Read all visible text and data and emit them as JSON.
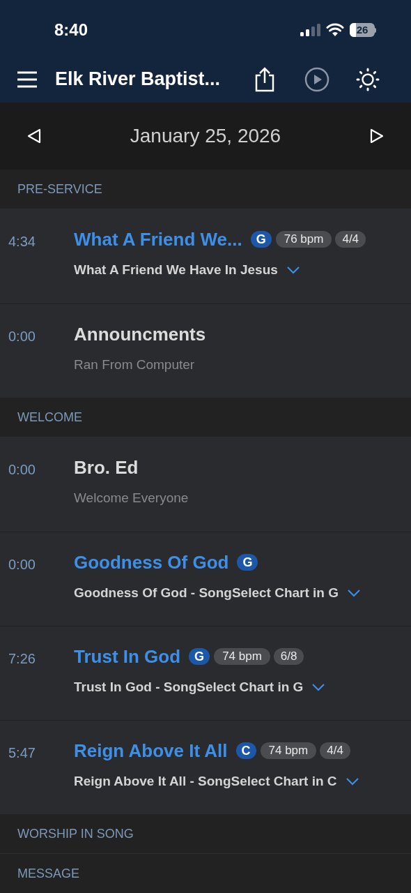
{
  "status_bar": {
    "time": "8:40",
    "battery": "26"
  },
  "header": {
    "title": "Elk River Baptist..."
  },
  "date_bar": {
    "date": "January 25, 2026"
  },
  "sections": [
    {
      "title": "PRE-SERVICE",
      "items": [
        {
          "kind": "song",
          "time": "4:34",
          "title": "What A Friend We...",
          "key": "G",
          "bpm": "76 bpm",
          "meter": "4/4",
          "subtitle": "What A Friend We Have In Jesus"
        },
        {
          "kind": "item",
          "time": "0:00",
          "title": "Announcments",
          "subtitle": "Ran From Computer"
        }
      ]
    },
    {
      "title": "WELCOME",
      "items": [
        {
          "kind": "item",
          "time": "0:00",
          "title": "Bro. Ed",
          "subtitle": "Welcome Everyone"
        },
        {
          "kind": "song",
          "time": "0:00",
          "title": "Goodness Of God",
          "key": "G",
          "subtitle": "Goodness Of God - SongSelect Chart in G"
        },
        {
          "kind": "song",
          "time": "7:26",
          "title": "Trust In God",
          "key": "G",
          "bpm": "74 bpm",
          "meter": "6/8",
          "subtitle": "Trust In God - SongSelect Chart in G"
        },
        {
          "kind": "song",
          "time": "5:47",
          "title": "Reign Above It All",
          "key": "C",
          "bpm": "74 bpm",
          "meter": "4/4",
          "subtitle": "Reign Above It All - SongSelect Chart in C"
        }
      ]
    },
    {
      "title": "WORSHIP IN SONG"
    },
    {
      "title": "MESSAGE"
    }
  ]
}
